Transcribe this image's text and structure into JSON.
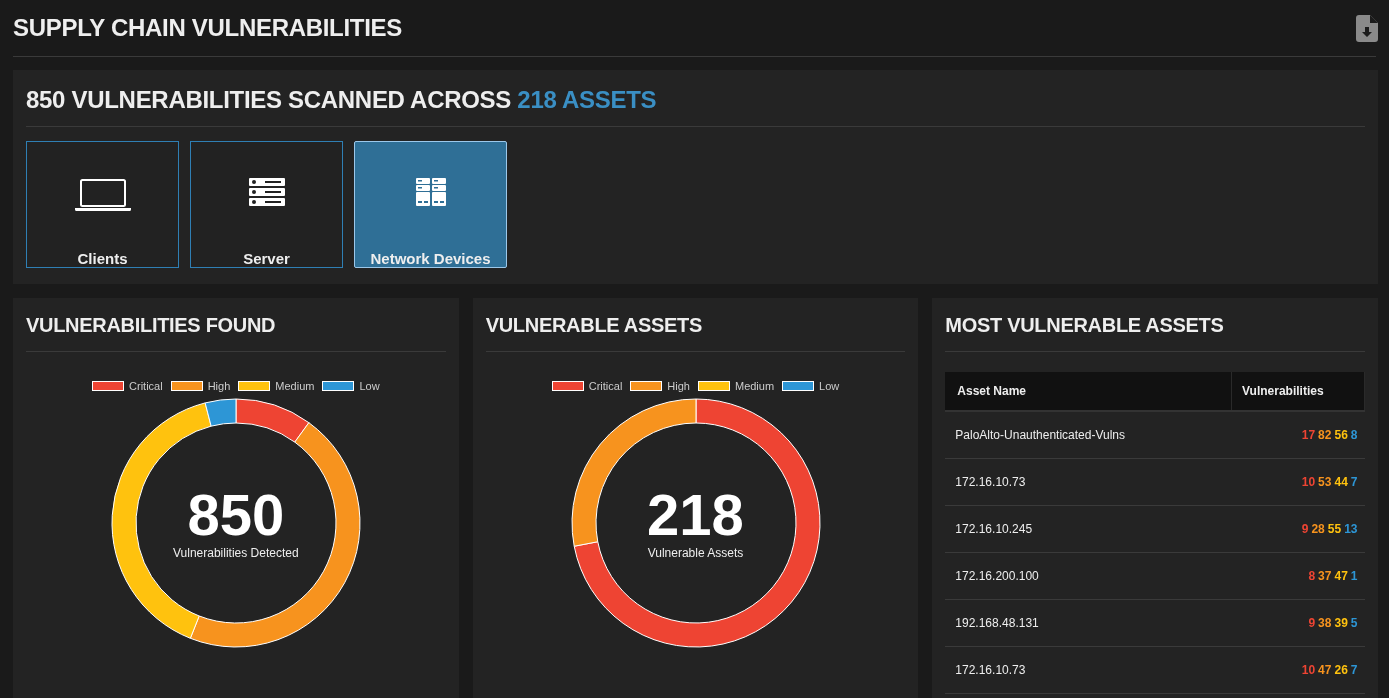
{
  "header": {
    "title": "SUPPLY CHAIN VULNERABILITIES"
  },
  "summary": {
    "title": "850 VULNERABILITIES SCANNED ACROSS **218 ASSETS**",
    "categories": [
      {
        "label": "Clients",
        "kind": "laptop",
        "selected": false
      },
      {
        "label": "Server",
        "kind": "server",
        "selected": false
      },
      {
        "label": "Network Devices",
        "kind": "network",
        "selected": true
      }
    ]
  },
  "panels": [
    {
      "title": "VULNERABILITIES FOUND",
      "kind": "donut",
      "legend": [
        {
          "label": "Critical",
          "color": "#ee4433"
        },
        {
          "label": "High",
          "color": "#f7931e"
        },
        {
          "label": "Medium",
          "color": "#ffc20e"
        },
        {
          "label": "Low",
          "color": "#2d96d6"
        }
      ],
      "center_value": "850",
      "center_label": "Vulnerabilities Detected"
    },
    {
      "title": "VULNERABLE ASSETS",
      "kind": "donut",
      "legend": [
        {
          "label": "Critical",
          "color": "#ee4433"
        },
        {
          "label": "High",
          "color": "#f7931e"
        },
        {
          "label": "Medium",
          "color": "#ffc20e"
        },
        {
          "label": "Low",
          "color": "#2d96d6"
        }
      ],
      "center_value": "218",
      "center_label": "Vulnerable Assets"
    },
    {
      "title": "MOST VULNERABLE ASSETS",
      "kind": "table",
      "columns": [
        "Asset Name",
        "Vulnerabilities"
      ],
      "rows": [
        {
          "name": "PaloAlto-Unauthenticated-Vulns",
          "counts": [
            {
              "value": "17",
              "color": "#ee4433"
            },
            {
              "value": "82",
              "color": "#f7931e"
            },
            {
              "value": "56",
              "color": "#ffc20e"
            },
            {
              "value": "8",
              "color": "#2d96d6"
            }
          ]
        },
        {
          "name": "172.16.10.73",
          "counts": [
            {
              "value": "10",
              "color": "#ee4433"
            },
            {
              "value": "53",
              "color": "#f7931e"
            },
            {
              "value": "44",
              "color": "#ffc20e"
            },
            {
              "value": "7",
              "color": "#2d96d6"
            }
          ]
        },
        {
          "name": "172.16.10.245",
          "counts": [
            {
              "value": "9",
              "color": "#ee4433"
            },
            {
              "value": "28",
              "color": "#f7931e"
            },
            {
              "value": "55",
              "color": "#ffc20e"
            },
            {
              "value": "13",
              "color": "#2d96d6"
            }
          ]
        },
        {
          "name": "172.16.200.100",
          "counts": [
            {
              "value": "8",
              "color": "#ee4433"
            },
            {
              "value": "37",
              "color": "#f7931e"
            },
            {
              "value": "47",
              "color": "#ffc20e"
            },
            {
              "value": "1",
              "color": "#2d96d6"
            }
          ]
        },
        {
          "name": "192.168.48.131",
          "counts": [
            {
              "value": "9",
              "color": "#ee4433"
            },
            {
              "value": "38",
              "color": "#f7931e"
            },
            {
              "value": "39",
              "color": "#ffc20e"
            },
            {
              "value": "5",
              "color": "#2d96d6"
            }
          ]
        },
        {
          "name": "172.16.10.73",
          "counts": [
            {
              "value": "10",
              "color": "#ee4433"
            },
            {
              "value": "47",
              "color": "#f7931e"
            },
            {
              "value": "26",
              "color": "#ffc20e"
            },
            {
              "value": "7",
              "color": "#2d96d6"
            }
          ]
        }
      ]
    }
  ]
}
